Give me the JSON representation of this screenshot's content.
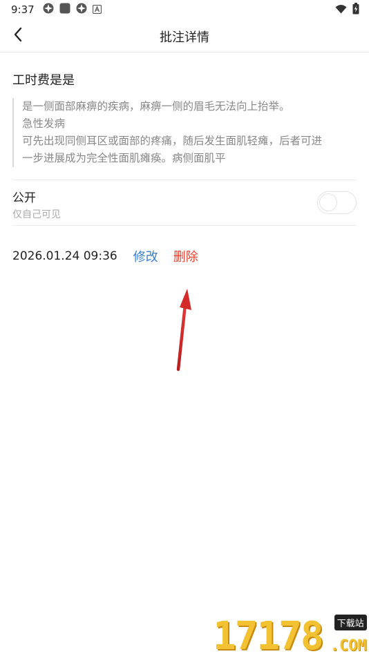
{
  "status_bar": {
    "time": "9:37",
    "icons": [
      "aperture-icon",
      "square-icon",
      "aperture-icon",
      "a-badge-icon"
    ],
    "right_icons": [
      "wifi-icon",
      "battery-charging-icon"
    ]
  },
  "header": {
    "back_icon": "chevron-left-icon",
    "title": "批注详情"
  },
  "note": {
    "title": "工时费是是",
    "quote_lines": [
      "是一侧面部麻痹的疾病，麻痹一侧的眉毛无法向上抬举。",
      "急性发病",
      "可先出现同侧耳区或面部的疼痛，随后发生面肌轻瘫，后者可进",
      "一步进展成为完全性面肌瘫痪。病侧面肌平"
    ]
  },
  "public_setting": {
    "label": "公开",
    "sub_label": "仅自己可见",
    "enabled": false
  },
  "meta": {
    "datetime": "2026.01.24 09:36",
    "edit_label": "修改",
    "delete_label": "删除"
  },
  "colors": {
    "edit": "#3a7fce",
    "delete": "#e8412f",
    "annotation_arrow": "#d42a2a",
    "watermark": "#f2c233"
  },
  "watermark": {
    "number": "17178",
    "tag": "下载站",
    "suffix": ".COM"
  }
}
